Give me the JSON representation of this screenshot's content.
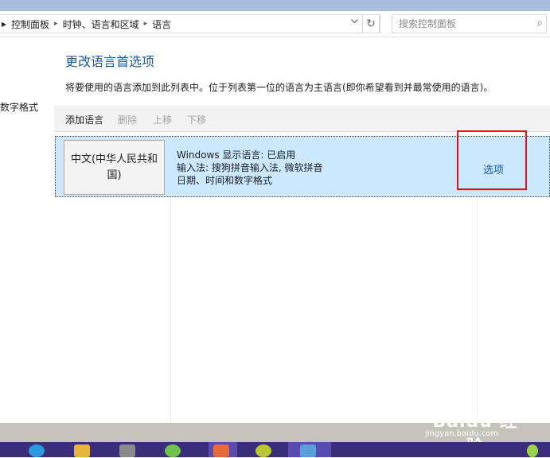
{
  "breadcrumb": {
    "lead": "▸",
    "items": [
      "控制面板",
      "时钟、语言和区域",
      "语言"
    ],
    "separator": "▸"
  },
  "address_dropdown_icon": "chevron-down-icon",
  "refresh_glyph": "↻",
  "search": {
    "placeholder": "搜索控制面板",
    "icon": "⌕"
  },
  "sidebar": {
    "partial_link": "数字格式"
  },
  "main": {
    "heading": "更改语言首选项",
    "description": "将要使用的语言添加到此列表中。位于列表第一位的语言为主语言(即你希望看到并最常使用的语言)。"
  },
  "toolbar": {
    "add": "添加语言",
    "remove": "删除",
    "move_up": "上移",
    "move_down": "下移"
  },
  "languages": [
    {
      "name": "中文(中华人民共和国)",
      "info_lines": [
        "Windows 显示语言: 已启用",
        "输入法: 搜狗拼音输入法, 微软拼音",
        "日期、时间和数字格式"
      ],
      "options": "选项"
    }
  ],
  "watermark": {
    "text": "Baidu 经验",
    "sub": "jingyan.baidu.com"
  },
  "colors": {
    "accent": "#1a5b9e",
    "selected_row": "#cce8ff",
    "highlight_box": "#d8121f",
    "taskbar": "#3a2d7a"
  }
}
